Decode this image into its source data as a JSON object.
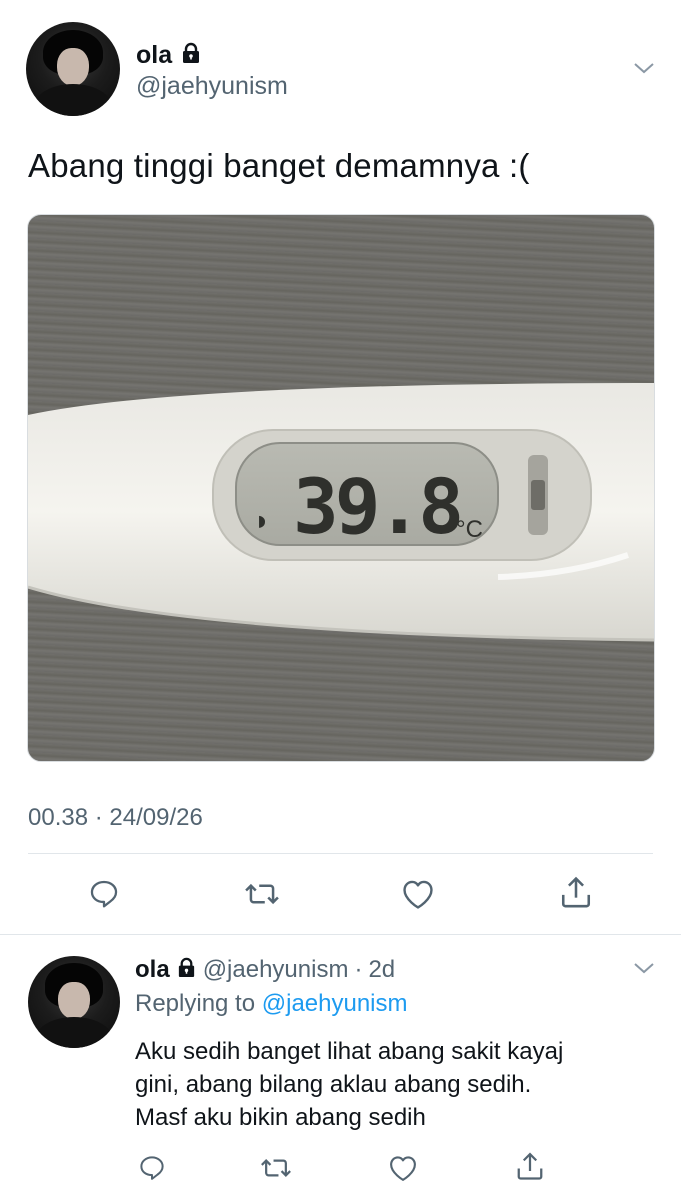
{
  "tweet": {
    "author_name": "ola",
    "author_handle": "@jaehyunism",
    "text": "Abang tinggi banget demamnya :(",
    "timestamp": "00.38 · 24/09/26",
    "image": {
      "description_icon": "thermometer-photo",
      "display_reading": "39.8",
      "display_unit": "°C"
    },
    "actions": [
      "reply-icon",
      "retweet-icon",
      "like-icon",
      "share-icon"
    ]
  },
  "reply": {
    "author_name": "ola",
    "author_handle": "@jaehyunism",
    "separator": "·",
    "age": "2d",
    "replying_to_prefix": "Replying to",
    "replying_to_handle": "@jaehyunism",
    "text_lines": [
      "Aku sedih banget lihat abang sakit kayaj",
      "gini, abang bilang aklau abang sedih.",
      "Masf aku bikin abang sedih"
    ],
    "actions": [
      "reply-icon",
      "retweet-icon",
      "like-icon",
      "share-icon"
    ]
  },
  "colors": {
    "text": "#0f1419",
    "secondary": "#536471",
    "link": "#1d9bf0",
    "divider": "#e1e6ea"
  }
}
